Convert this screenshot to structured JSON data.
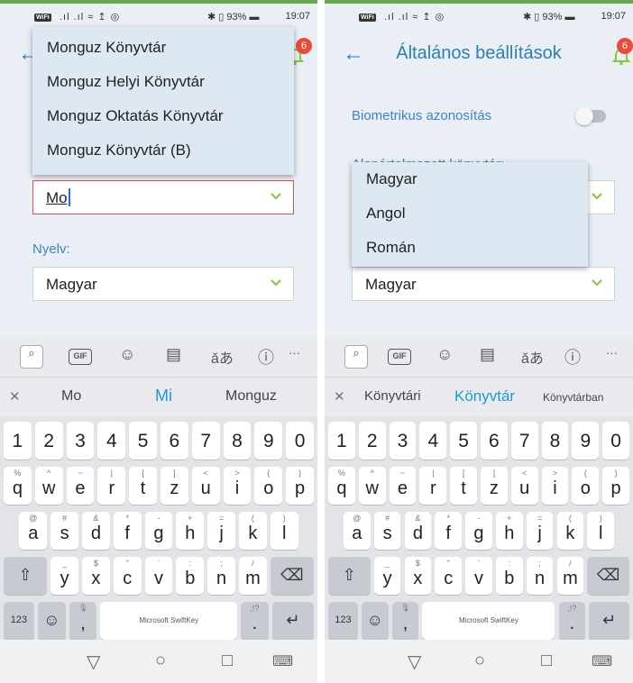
{
  "status": {
    "left": {
      "wifi": "WiFi",
      "time": "19:07",
      "battery": "93%"
    },
    "right": {
      "wifi": "WiFi",
      "time": "19:07",
      "battery": "93%"
    }
  },
  "left_screen": {
    "library_options": [
      "Monguz Könyvtár",
      "Monguz Helyi Könyvtár",
      "Monguz Oktatás Könyvtár",
      "Monguz Könyvtár (B)"
    ],
    "library_input_value": "Mo",
    "language_label": "Nyelv:",
    "language_value": "Magyar",
    "badge_count": "6"
  },
  "right_screen": {
    "title": "Általános beállítások",
    "biometric_label": "Biometrikus azonosítás",
    "default_library_label": "Alapértelmezett könyvtár:",
    "language_options": [
      "Magyar",
      "Angol",
      "Román"
    ],
    "language_value": "Magyar",
    "badge_count": "6"
  },
  "keyboard": {
    "left_suggestions": [
      "Mo",
      "Mi",
      "Monguz"
    ],
    "right_suggestions": [
      "Könyvtári",
      "Könyvtár",
      "Könyvtárban"
    ],
    "number_row": [
      "1",
      "2",
      "3",
      "4",
      "5",
      "6",
      "7",
      "8",
      "9",
      "0"
    ],
    "row1": [
      {
        "k": "q",
        "s": "%"
      },
      {
        "k": "w",
        "s": "^"
      },
      {
        "k": "e",
        "s": "~"
      },
      {
        "k": "r",
        "s": "|"
      },
      {
        "k": "t",
        "s": "["
      },
      {
        "k": "z",
        "s": "]"
      },
      {
        "k": "u",
        "s": "<"
      },
      {
        "k": "i",
        "s": ">"
      },
      {
        "k": "o",
        "s": "{"
      },
      {
        "k": "p",
        "s": "}"
      }
    ],
    "row2": [
      {
        "k": "a",
        "s": "@"
      },
      {
        "k": "s",
        "s": "#"
      },
      {
        "k": "d",
        "s": "&"
      },
      {
        "k": "f",
        "s": "*"
      },
      {
        "k": "g",
        "s": "-"
      },
      {
        "k": "h",
        "s": "+"
      },
      {
        "k": "j",
        "s": "="
      },
      {
        "k": "k",
        "s": "("
      },
      {
        "k": "l",
        "s": ")"
      }
    ],
    "row3": [
      {
        "k": "y",
        "s": "_"
      },
      {
        "k": "x",
        "s": "$"
      },
      {
        "k": "c",
        "s": "\""
      },
      {
        "k": "v",
        "s": "'"
      },
      {
        "k": "b",
        "s": ":"
      },
      {
        "k": "n",
        "s": ";"
      },
      {
        "k": "m",
        "s": "/"
      }
    ],
    "num_key": "123",
    "space_label": "Microsoft SwiftKey",
    "comma": ",",
    "period": ".",
    "period_sub": ",!?",
    "gif": "GIF",
    "more": "···"
  },
  "icons": {
    "accent": "#2e7fb0",
    "bell_color": "#8bc34a",
    "badge_color": "#e74c3c",
    "chevron_color": "#8bc34a"
  }
}
